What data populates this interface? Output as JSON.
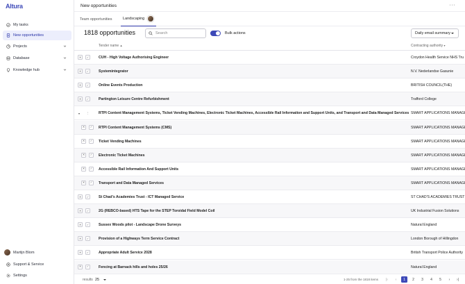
{
  "app": {
    "logo": "Altura"
  },
  "sidebar": {
    "items": [
      {
        "label": "My tasks",
        "icon": "check-circle-icon"
      },
      {
        "label": "New opportunities",
        "icon": "document-icon",
        "active": true
      },
      {
        "label": "Projects",
        "icon": "projects-icon"
      },
      {
        "label": "Database",
        "icon": "database-icon"
      },
      {
        "label": "Knowledge hub",
        "icon": "lightbulb-icon"
      }
    ],
    "user": "Martijn Blom",
    "support": "Support & Service",
    "settings": "Settings"
  },
  "header": {
    "title": "New opportunities",
    "more": "···"
  },
  "tabs": [
    {
      "label": "Team opportunities"
    },
    {
      "label": "Landscaping",
      "active": true
    }
  ],
  "toolbar": {
    "count": "1818 opportunities",
    "search_placeholder": "Search",
    "bulk_label": "Bulk actions",
    "dropdown_value": "Daily email summary"
  },
  "table": {
    "col_name": "Tender name",
    "col_authority": "Contracting authority",
    "rows": [
      {
        "name": "CUH - High Voltage Authorising Engineer",
        "authority": "Croydon Health Service NHS Tru"
      },
      {
        "name": "Systemintegrator",
        "authority": "N.V. Nederlandse Gasunie"
      },
      {
        "name": "Online Events Production",
        "authority": "BRITISH COUNCIL(THE)"
      },
      {
        "name": "Partington Leisure Centre Refurbishment",
        "authority": "Trafford College"
      },
      {
        "name": "RTPI Content Management Systems, Ticket Vending Machines, Electronic Ticket Machines, Accessible Rail Information and Support Units, and Transport and Data Managed Services",
        "authority": "SMART APPLICATIONS MANAGE"
      },
      {
        "name": "RTPI Content Management Systems (CMS)",
        "authority": "SMART APPLICATIONS MANAGE",
        "child": true
      },
      {
        "name": "Ticket Vending Machines",
        "authority": "SMART APPLICATIONS MANAGE",
        "child": true
      },
      {
        "name": "Electronic Ticket Machines",
        "authority": "SMART APPLICATIONS MANAGE",
        "child": true
      },
      {
        "name": "Accessible Rail Information And Support Units",
        "authority": "SMART APPLICATIONS MANAGE",
        "child": true
      },
      {
        "name": "Transport and Data Managed Services",
        "authority": "SMART APPLICATIONS MANAGE",
        "child": true
      },
      {
        "name": "St Chad's Academies Trust - ICT Managed Service",
        "authority": "ST CHAD'S ACADEMIES TRUST"
      },
      {
        "name": "2G (REBCO-based) HTS Tape for the STEP Toroidal Field Model Coil",
        "authority": "UK Industrial Fusion Solutions"
      },
      {
        "name": "Sussex Woods pilot - Landscape Drone Surveys",
        "authority": "Natural England"
      },
      {
        "name": "Provision of a Highways Term Service Contract",
        "authority": "London Borough of Hillingdon"
      },
      {
        "name": "Appropriate Adult Service 2028",
        "authority": "British Transport Police Authority"
      },
      {
        "name": "Fencing at Barnack hills and holes 25/26",
        "authority": "Natural England"
      }
    ]
  },
  "footer": {
    "results_label": "results",
    "results_value": "25",
    "range": "1-25 from the 1818 items",
    "pages": [
      "1",
      "2",
      "3",
      "4",
      "5"
    ],
    "active_page": "1"
  }
}
